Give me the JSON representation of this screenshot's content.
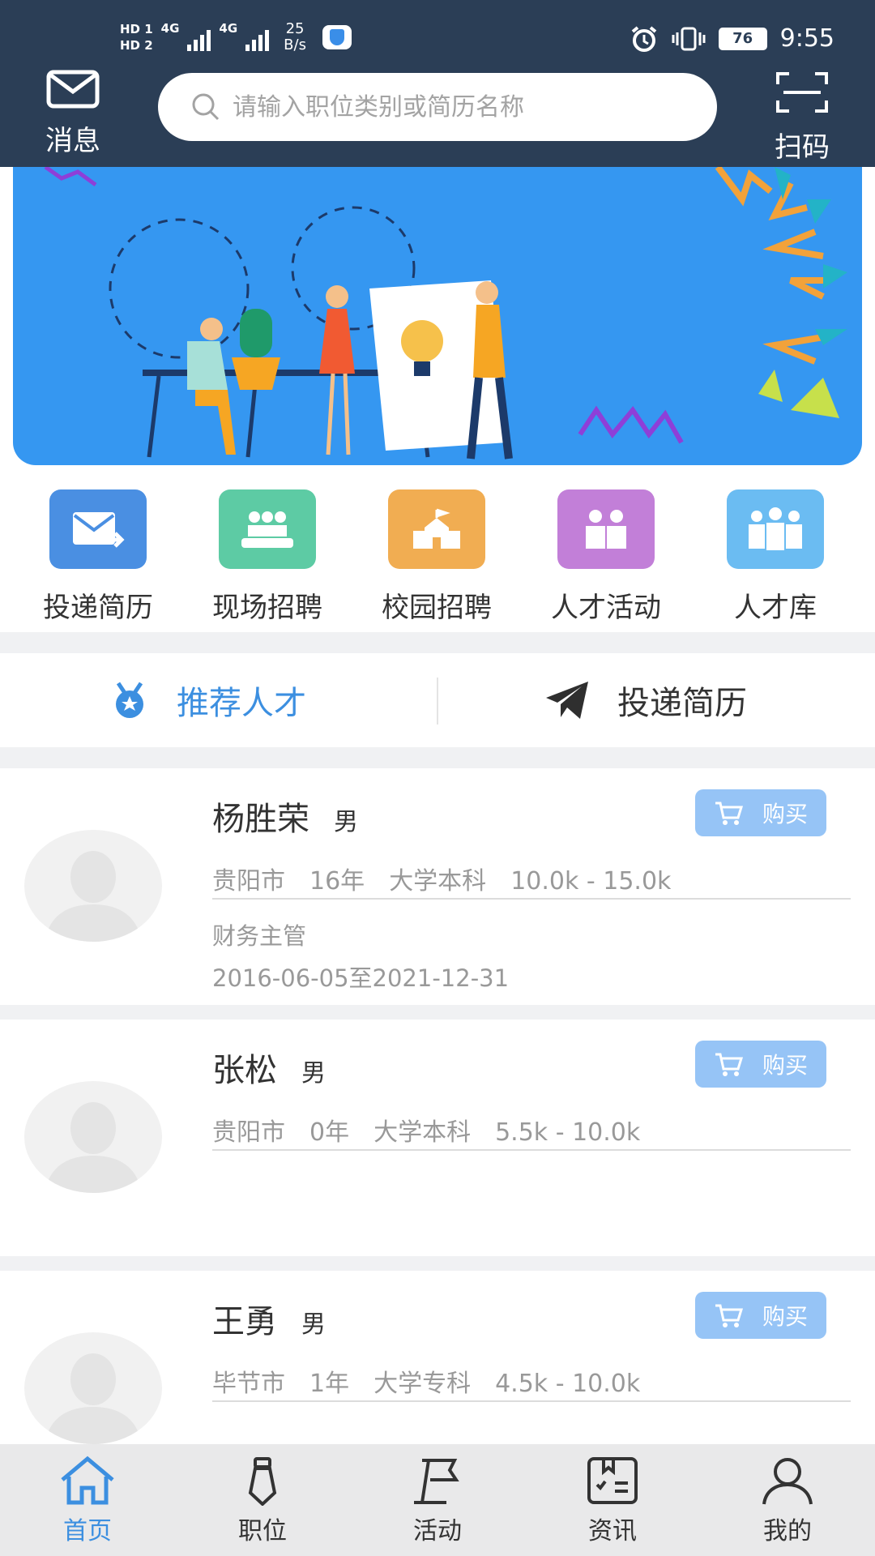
{
  "status_bar": {
    "sim1": "HD 1",
    "sim2": "HD 2",
    "net1": "4G",
    "net2": "4G",
    "speed_value": "25",
    "speed_unit": "B/s",
    "battery": "76",
    "time": "9:55"
  },
  "header": {
    "message_label": "消息",
    "scan_label": "扫码",
    "search_placeholder": "请输入职位类别或简历名称"
  },
  "menu": [
    {
      "label": "投递简历",
      "color": "#4a8fe2",
      "icon": "envelope-send-icon"
    },
    {
      "label": "现场招聘",
      "color": "#5dcba4",
      "icon": "meeting-icon"
    },
    {
      "label": "校园招聘",
      "color": "#f1ad52",
      "icon": "school-icon"
    },
    {
      "label": "人才活动",
      "color": "#c27fd8",
      "icon": "people-activity-icon"
    },
    {
      "label": "人才库",
      "color": "#6bbcf2",
      "icon": "people-group-icon"
    }
  ],
  "tabs": {
    "recommend": "推荐人才",
    "deliver": "投递简历"
  },
  "candidates": [
    {
      "name": "杨胜荣",
      "gender": "男",
      "city": "贵阳市",
      "years": "16年",
      "education": "大学本科",
      "salary": "10.0k - 15.0k",
      "job": "财务主管",
      "period": "2016-06-05至2021-12-31",
      "buy_label": "购买"
    },
    {
      "name": "张松",
      "gender": "男",
      "city": "贵阳市",
      "years": "0年",
      "education": "大学本科",
      "salary": "5.5k - 10.0k",
      "job": "",
      "period": "",
      "buy_label": "购买"
    },
    {
      "name": "王勇",
      "gender": "男",
      "city": "毕节市",
      "years": "1年",
      "education": "大学专科",
      "salary": "4.5k - 10.0k",
      "job": "",
      "period": "",
      "buy_label": "购买"
    }
  ],
  "bottom_nav": [
    {
      "label": "首页",
      "icon": "home-icon",
      "active": true
    },
    {
      "label": "职位",
      "icon": "tie-icon",
      "active": false
    },
    {
      "label": "活动",
      "icon": "flag-icon",
      "active": false
    },
    {
      "label": "资讯",
      "icon": "news-icon",
      "active": false
    },
    {
      "label": "我的",
      "icon": "user-icon",
      "active": false
    }
  ],
  "colors": {
    "header_bg": "#2b3e56",
    "accent": "#3c8fe0",
    "buy_button": "#96c4f6",
    "banner_bg": "#3597f1"
  }
}
